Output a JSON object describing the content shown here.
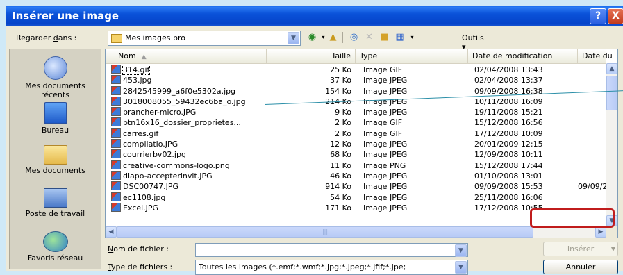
{
  "dialog": {
    "title": "Insérer une image",
    "help_label": "?",
    "close_label": "X"
  },
  "lookin": {
    "label_pre": "Regarder ",
    "label_u": "d",
    "label_post": "ans :",
    "value": "Mes images pro"
  },
  "toolbar": {
    "outils_label": "Outils ▾"
  },
  "places": [
    {
      "label": "Mes documents récents",
      "icon": "recent-documents-icon"
    },
    {
      "label": "Bureau",
      "icon": "desktop-icon"
    },
    {
      "label": "Mes documents",
      "icon": "my-documents-icon"
    },
    {
      "label": "Poste de travail",
      "icon": "my-computer-icon"
    },
    {
      "label": "Favoris réseau",
      "icon": "network-places-icon"
    }
  ],
  "columns": {
    "name": "Nom",
    "size": "Taille",
    "type": "Type",
    "date_modified": "Date de modification",
    "date_taken": "Date du"
  },
  "files": [
    {
      "name": "314.gif",
      "size": "25 Ko",
      "type": "Image GIF",
      "date": "02/04/2008 13:43",
      "date2": ""
    },
    {
      "name": "453.jpg",
      "size": "37 Ko",
      "type": "Image JPEG",
      "date": "02/04/2008 13:37",
      "date2": ""
    },
    {
      "name": "2842545999_a6f0e5302a.jpg",
      "size": "154 Ko",
      "type": "Image JPEG",
      "date": "09/09/2008 16:38",
      "date2": ""
    },
    {
      "name": "3018008055_59432ec6ba_o.jpg",
      "size": "214 Ko",
      "type": "Image JPEG",
      "date": "10/11/2008 16:09",
      "date2": ""
    },
    {
      "name": "brancher-micro.JPG",
      "size": "9 Ko",
      "type": "Image JPEG",
      "date": "19/11/2008 15:21",
      "date2": ""
    },
    {
      "name": "btn16x16_dossier_proprietes...",
      "size": "2 Ko",
      "type": "Image GIF",
      "date": "15/12/2008 16:56",
      "date2": ""
    },
    {
      "name": "carres.gif",
      "size": "2 Ko",
      "type": "Image GIF",
      "date": "17/12/2008 10:09",
      "date2": ""
    },
    {
      "name": "compilatio.JPG",
      "size": "12 Ko",
      "type": "Image JPEG",
      "date": "20/01/2009 12:15",
      "date2": ""
    },
    {
      "name": "courrierbv02.jpg",
      "size": "68 Ko",
      "type": "Image JPEG",
      "date": "12/09/2008 10:11",
      "date2": ""
    },
    {
      "name": "creative-commons-logo.png",
      "size": "11 Ko",
      "type": "Image PNG",
      "date": "15/12/2008 17:44",
      "date2": ""
    },
    {
      "name": "diapo-accepterinvit.JPG",
      "size": "46 Ko",
      "type": "Image JPEG",
      "date": "01/10/2008 13:01",
      "date2": ""
    },
    {
      "name": "DSC00747.JPG",
      "size": "914 Ko",
      "type": "Image JPEG",
      "date": "09/09/2008 15:53",
      "date2": "09/09/2"
    },
    {
      "name": "ec1108.jpg",
      "size": "54 Ko",
      "type": "Image JPEG",
      "date": "25/11/2008 16:06",
      "date2": ""
    },
    {
      "name": "Excel.JPG",
      "size": "171 Ko",
      "type": "Image JPEG",
      "date": "17/12/2008 10:55",
      "date2": ""
    }
  ],
  "form": {
    "filename_label_u": "N",
    "filename_label_post": "om de fichier :",
    "filename_value": "",
    "filetype_label_u": "T",
    "filetype_label_post": "ype de fichiers :",
    "filetype_value": "Toutes les images (*.emf;*.wmf;*.jpg;*.jpeg;*.jfif;*.jpe;"
  },
  "buttons": {
    "insert_label": "Insérer",
    "cancel_label": "Annuler"
  }
}
